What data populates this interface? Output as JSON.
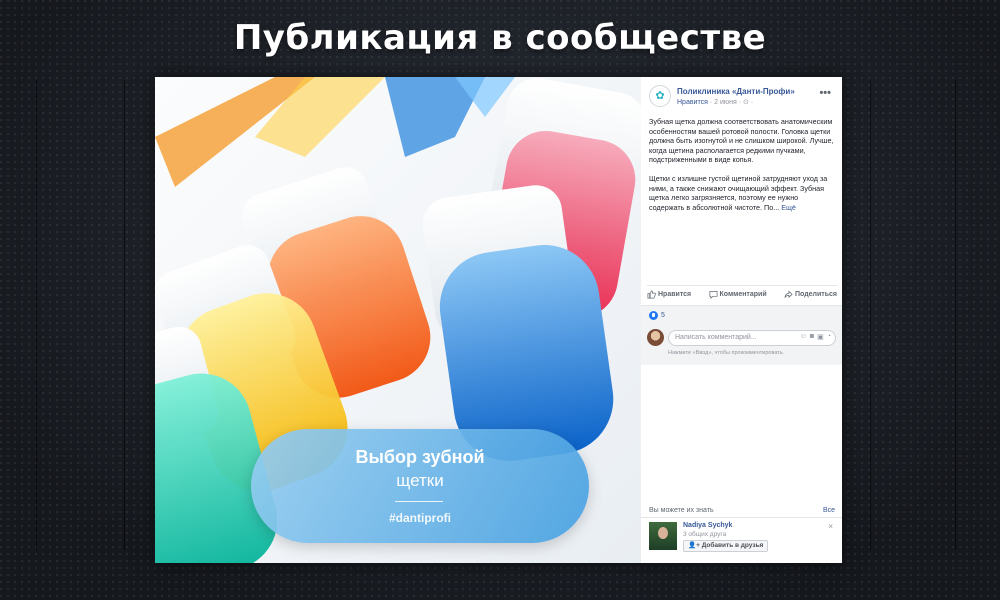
{
  "page_title": "Публикация в сообществе",
  "image": {
    "banner_title": "Выбор зубной",
    "banner_subtitle": "щетки",
    "banner_tag": "#dantiprofi"
  },
  "post": {
    "page_name": "Поликлиника «Данти-Профи»",
    "like_link": "Нравится",
    "date": "2 июня",
    "privacy_icon": "globe-icon",
    "more_icon": "more-dots-icon",
    "paragraphs": [
      "Зубная щетка должна соответствовать анатомическим особенностям вашей ротовой полости. Головка щетки должна быть изогнутой и не слишком широкой. Лучше, когда щетина располагается редкими пучками, подстриженными в виде копья.",
      "Щетки с излишне густой щетиной затрудняют уход за ними, а также снижают очищающий эффект. Зубная щетка легко загрязняется, поэтому ее нужно содержать в абсолютной чистоте. По..."
    ],
    "see_more": "Ещё"
  },
  "actions": {
    "like": "Нравится",
    "comment": "Комментарий",
    "share": "Поделиться"
  },
  "reactions": {
    "count": "5"
  },
  "comment": {
    "placeholder": "Написать комментарий...",
    "hint": "Нажмите «Ввод», чтобы прокомментировать."
  },
  "pymk": {
    "title": "Вы можете их знать",
    "see_all": "Все",
    "friend": {
      "name": "Nadiya Sychyk",
      "mutual": "3 общих друга",
      "add_label": "Добавить в друзья",
      "close_icon": "×"
    }
  },
  "colors": {
    "link_blue": "#385898",
    "like_blue": "#2078f4",
    "title_white": "#ffffff"
  }
}
